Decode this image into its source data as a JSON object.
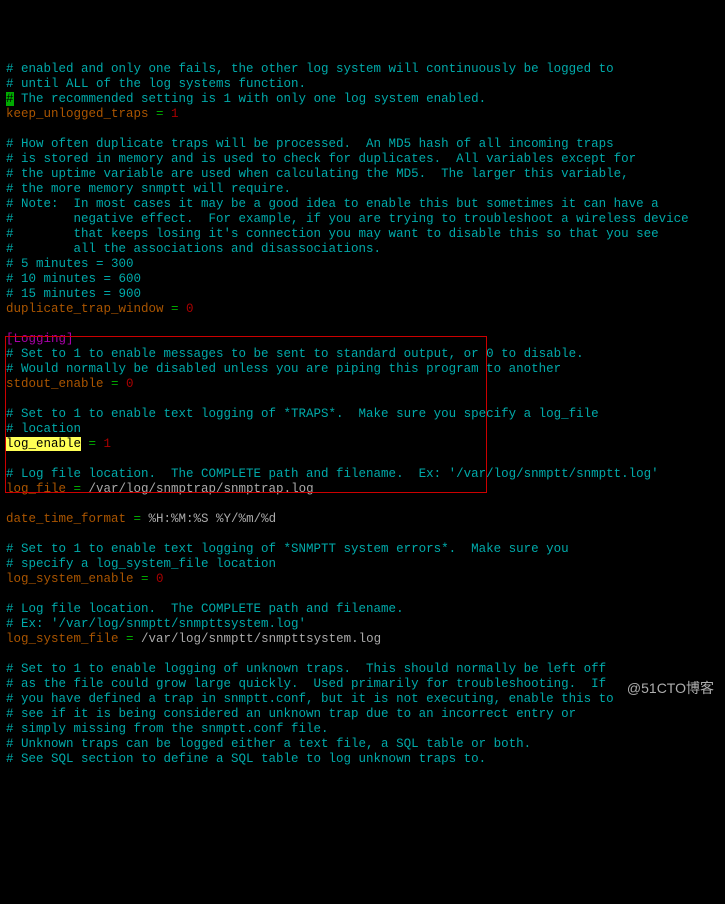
{
  "watermark": "@51CTO博客",
  "lines": [
    [
      [
        "c",
        "# enabled and only one fails, the other log system will continuously be logged to"
      ]
    ],
    [
      [
        "c",
        "# until ALL of the log systems function."
      ]
    ],
    [
      [
        "hl-g",
        "#"
      ],
      [
        "c",
        " The recommended setting is 1 with only one log system enabled."
      ]
    ],
    [
      [
        "k",
        "keep_unlogged_traps "
      ],
      [
        "eq",
        "= "
      ],
      [
        "vnum",
        "1"
      ]
    ],
    [
      [
        "c",
        ""
      ]
    ],
    [
      [
        "c",
        "# How often duplicate traps will be processed.  An MD5 hash of all incoming traps"
      ]
    ],
    [
      [
        "c",
        "# is stored in memory and is used to check for duplicates.  All variables except for"
      ]
    ],
    [
      [
        "c",
        "# the uptime variable are used when calculating the MD5.  The larger this variable,"
      ]
    ],
    [
      [
        "c",
        "# the more memory snmptt will require."
      ]
    ],
    [
      [
        "c",
        "# Note:  In most cases it may be a good idea to enable this but sometimes it can have a"
      ]
    ],
    [
      [
        "c",
        "#        negative effect.  For example, if you are trying to troubleshoot a wireless device"
      ]
    ],
    [
      [
        "c",
        "#        that keeps losing it's connection you may want to disable this so that you see"
      ]
    ],
    [
      [
        "c",
        "#        all the associations and disassociations."
      ]
    ],
    [
      [
        "c",
        "# 5 minutes = 300"
      ]
    ],
    [
      [
        "c",
        "# 10 minutes = 600"
      ]
    ],
    [
      [
        "c",
        "# 15 minutes = 900"
      ]
    ],
    [
      [
        "k",
        "duplicate_trap_window "
      ],
      [
        "eq",
        "= "
      ],
      [
        "vnum",
        "0"
      ]
    ],
    [
      [
        "c",
        ""
      ]
    ],
    [
      [
        "sec",
        "[Logging]"
      ]
    ],
    [
      [
        "c",
        "# Set to 1 to enable messages to be sent to standard output, or 0 to disable."
      ]
    ],
    [
      [
        "c",
        "# Would normally be disabled unless you are piping this program to another"
      ]
    ],
    [
      [
        "k",
        "stdout_enable "
      ],
      [
        "eq",
        "= "
      ],
      [
        "vnum",
        "0"
      ]
    ],
    [
      [
        "c",
        ""
      ]
    ],
    [
      [
        "c",
        "# Set to 1 to enable text logging of *TRAPS*.  Make sure you specify a log_file"
      ]
    ],
    [
      [
        "c",
        "# location"
      ]
    ],
    [
      [
        "hl-y",
        "log_enable"
      ],
      [
        "k",
        " "
      ],
      [
        "eq",
        "= "
      ],
      [
        "vnum",
        "1"
      ]
    ],
    [
      [
        "c",
        ""
      ]
    ],
    [
      [
        "c",
        "# Log file location.  The COMPLETE path and filename.  Ex: '/var/log/snmptt/snmptt.log'"
      ]
    ],
    [
      [
        "k",
        "log_file "
      ],
      [
        "eq",
        "= "
      ],
      [
        "vstr",
        "/var/log/snmptrap/snmptrap.log"
      ]
    ],
    [
      [
        "c",
        ""
      ]
    ],
    [
      [
        "k",
        "date_time_format "
      ],
      [
        "eq",
        "= "
      ],
      [
        "vstr",
        "%H:%M:%S %Y/%m/%d"
      ]
    ],
    [
      [
        "c",
        ""
      ]
    ],
    [
      [
        "c",
        "# Set to 1 to enable text logging of *SNMPTT system errors*.  Make sure you"
      ]
    ],
    [
      [
        "c",
        "# specify a log_system_file location"
      ]
    ],
    [
      [
        "k",
        "log_system_enable "
      ],
      [
        "eq",
        "= "
      ],
      [
        "vnum",
        "0"
      ]
    ],
    [
      [
        "c",
        ""
      ]
    ],
    [
      [
        "c",
        "# Log file location.  The COMPLETE path and filename."
      ]
    ],
    [
      [
        "c",
        "# Ex: '/var/log/snmptt/snmpttsystem.log'"
      ]
    ],
    [
      [
        "k",
        "log_system_file "
      ],
      [
        "eq",
        "= "
      ],
      [
        "vstr",
        "/var/log/snmptt/snmpttsystem.log"
      ]
    ],
    [
      [
        "c",
        ""
      ]
    ],
    [
      [
        "c",
        "# Set to 1 to enable logging of unknown traps.  This should normally be left off"
      ]
    ],
    [
      [
        "c",
        "# as the file could grow large quickly.  Used primarily for troubleshooting.  If"
      ]
    ],
    [
      [
        "c",
        "# you have defined a trap in snmptt.conf, but it is not executing, enable this to"
      ]
    ],
    [
      [
        "c",
        "# see if it is being considered an unknown trap due to an incorrect entry or"
      ]
    ],
    [
      [
        "c",
        "# simply missing from the snmptt.conf file."
      ]
    ],
    [
      [
        "c",
        "# Unknown traps can be logged either a text file, a SQL table or both."
      ]
    ],
    [
      [
        "c",
        "# See SQL section to define a SQL table to log unknown traps to."
      ]
    ]
  ]
}
